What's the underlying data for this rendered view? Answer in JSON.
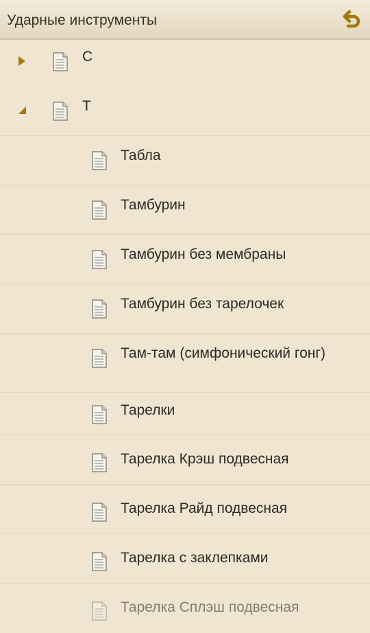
{
  "header": {
    "title": "Ударные инструменты",
    "back_icon": "back-arrow-icon",
    "accent": "#a07a10"
  },
  "groups": [
    {
      "label": "С",
      "expanded": false
    },
    {
      "label": "Т",
      "expanded": true
    }
  ],
  "items": [
    "Табла",
    "Тамбурин",
    "Тамбурин без мембраны",
    "Тамбурин без тарелочек",
    "Там-там (симфонический гонг)",
    "Тарелки",
    "Тарелка Крэш подвесная",
    "Тарелка Райд подвесная",
    "Тарелка с заклепками",
    "Тарелка Сплэш подвесная"
  ]
}
